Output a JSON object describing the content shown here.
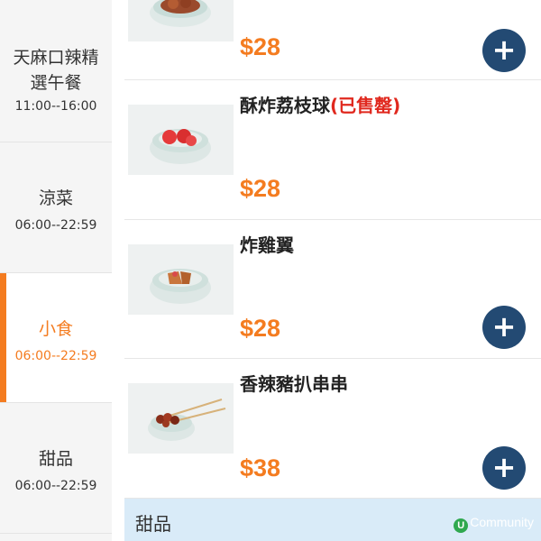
{
  "sidebar": {
    "categories": [
      {
        "name": "天麻口辣精選午餐",
        "time": "11:00--16:00",
        "active": false
      },
      {
        "name": "涼菜",
        "time": "06:00--22:59",
        "active": false
      },
      {
        "name": "小食",
        "time": "06:00--22:59",
        "active": true
      },
      {
        "name": "甜品",
        "time": "06:00--22:59",
        "active": false
      }
    ]
  },
  "items": [
    {
      "name": "",
      "price": "$28",
      "sold_out": ""
    },
    {
      "name": "酥炸荔枝球",
      "sold_out": "(已售罄)",
      "price": "$28"
    },
    {
      "name": "炸雞翼",
      "sold_out": "",
      "price": "$28"
    },
    {
      "name": "香辣豬扒串串",
      "sold_out": "",
      "price": "$38"
    }
  ],
  "section_header": {
    "title": "甜品"
  },
  "watermark": {
    "text": "Community",
    "badge": "U"
  },
  "add_button": {
    "symbol": "+"
  },
  "colors": {
    "accent": "#f47c20",
    "add_button": "#234a73",
    "sold_out": "#e0281e",
    "section_bg": "#d9ebf8"
  }
}
